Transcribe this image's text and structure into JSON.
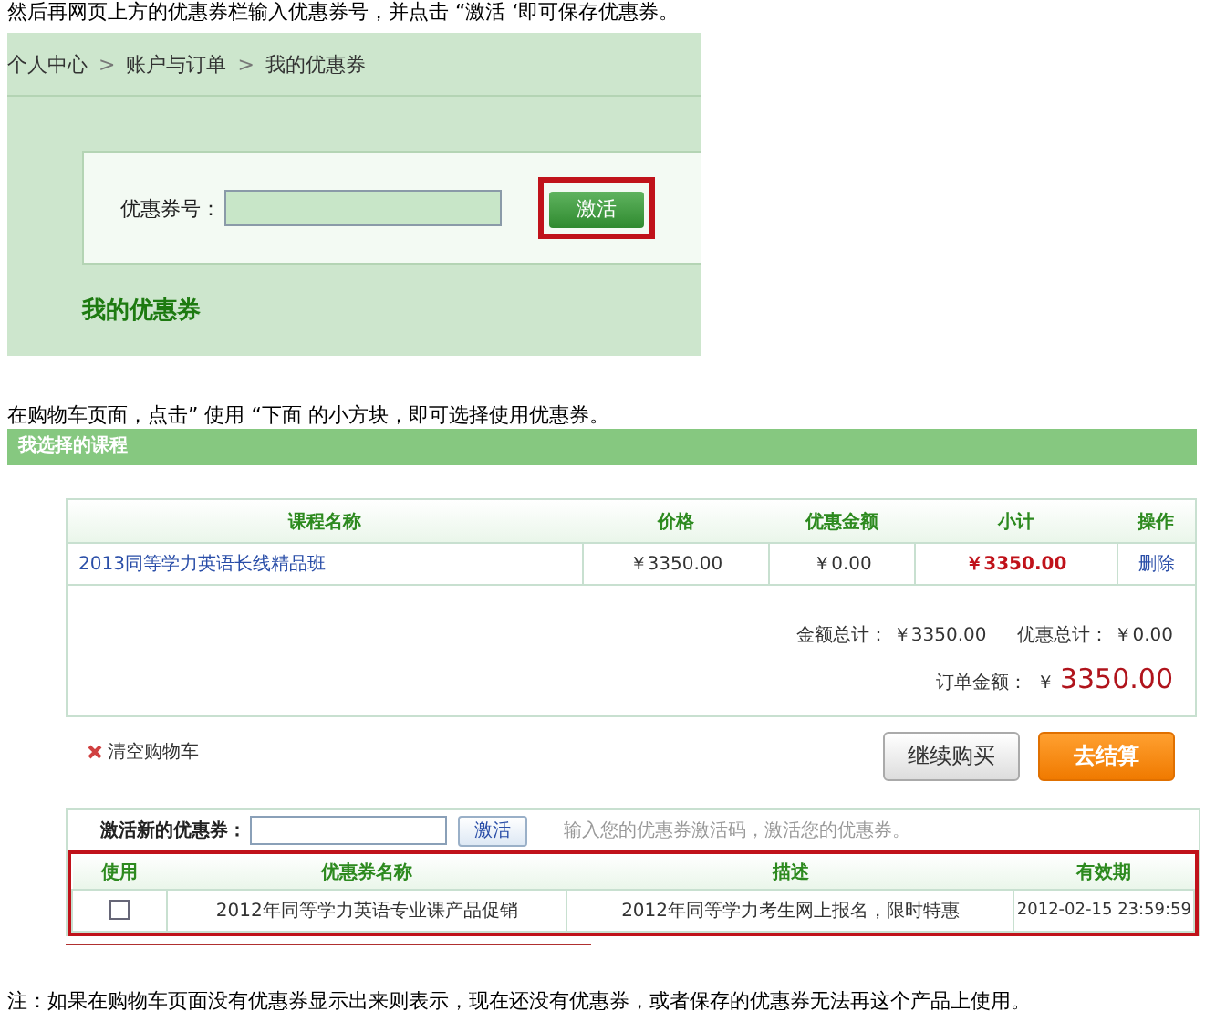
{
  "instructions": [
    "然后再网页上方的优惠券栏输入优惠券号，并点击 “激活 ‘即可保存优惠券。",
    "在购物车页面，点击” 使用 “下面 的小方块，即可选择使用优惠券。"
  ],
  "coupon_page": {
    "breadcrumb": [
      "个人中心",
      "账户与订单",
      "我的优惠券"
    ],
    "separator": ">",
    "field_label": "优惠券号：",
    "activate_button": {
      "label": "激活",
      "highlighted": true
    },
    "heading": "我的优惠券"
  },
  "cart": {
    "title": "我选择的课程",
    "columns": [
      "课程名称",
      "价格",
      "优惠金额",
      "小计",
      "操作"
    ],
    "rows": [
      {
        "name": "2013同等学力英语长线精品班",
        "price": "￥3350.00",
        "discount": "￥0.00",
        "subtotal": "￥3350.00",
        "action": "删除"
      }
    ],
    "amount_label": "金额总计：",
    "amount": "￥3350.00",
    "discount_label": "优惠总计：",
    "discount_total": "￥0.00",
    "order_label": "订单金额：",
    "order_currency": "￥",
    "order_total": "3350.00",
    "clear_link": "清空购物车",
    "continue_button": "继续购买",
    "checkout_button": "去结算",
    "coupon": {
      "label": "激活新的优惠券：",
      "button": "激活",
      "hint": "输入您的优惠券激活码，激活您的优惠券。",
      "highlighted": true,
      "columns": [
        "使用",
        "优惠券名称",
        "描述",
        "有效期"
      ],
      "rows": [
        {
          "checked": false,
          "name": "2012年同等学力英语专业课产品促销",
          "description": "2012年同等学力考生网上报名，限时特惠",
          "expires": "2012-02-15 23:59:59"
        }
      ]
    }
  },
  "note": "注：如果在购物车页面没有优惠券显示出来则表示，现在还没有优惠券，或者保存的优惠券无法再这个产品上使用。"
}
